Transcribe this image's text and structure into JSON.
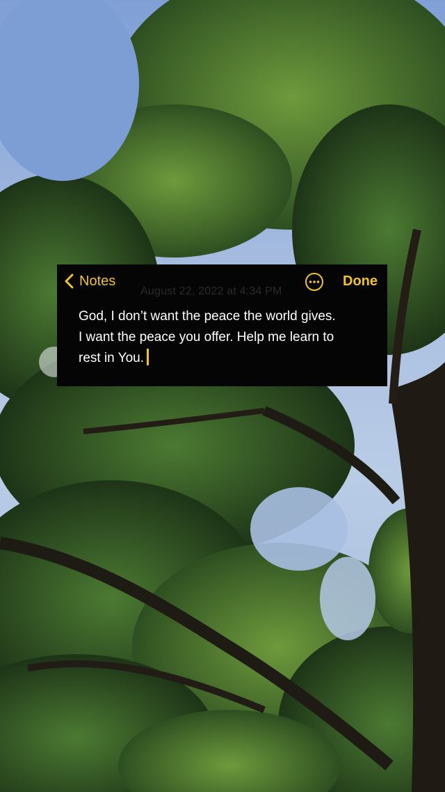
{
  "background": {
    "description_icon": "tree-canopy-photo",
    "sky_color": "#9fb8da",
    "leaf_color": "#3f6a2c"
  },
  "note": {
    "back_label": "Notes",
    "date_text": "August 22, 2022 at 4:34 PM",
    "done_label": "Done",
    "more_icon": "ellipsis-circle-icon",
    "lines": [
      "God, I don’t want the peace the world gives.",
      "I want the peace you offer. Help me learn to",
      "rest in You."
    ],
    "accent_color": "#f2c330"
  }
}
